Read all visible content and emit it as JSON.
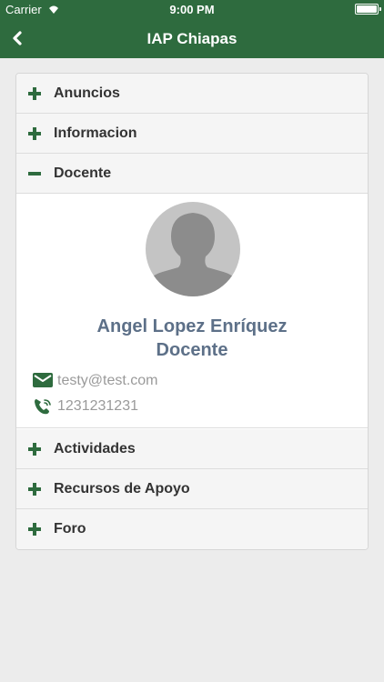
{
  "status_bar": {
    "carrier": "Carrier",
    "time": "9:00 PM"
  },
  "navbar": {
    "title": "IAP Chiapas",
    "back_icon": "chevron-left-icon"
  },
  "accordion": {
    "items": [
      {
        "label": "Anuncios",
        "expanded": false
      },
      {
        "label": "Informacion",
        "expanded": false
      },
      {
        "label": "Docente",
        "expanded": true
      },
      {
        "label": "Actividades",
        "expanded": false
      },
      {
        "label": "Recursos de Apoyo",
        "expanded": false
      },
      {
        "label": "Foro",
        "expanded": false
      }
    ]
  },
  "teacher": {
    "name": "Angel Lopez Enríquez",
    "role": "Docente",
    "email": "testy@test.com",
    "phone": "1231231231"
  },
  "colors": {
    "primary": "#2e6b3e",
    "name_text": "#5d7088",
    "contact_text": "#9a9a9a",
    "background": "#ececec"
  }
}
